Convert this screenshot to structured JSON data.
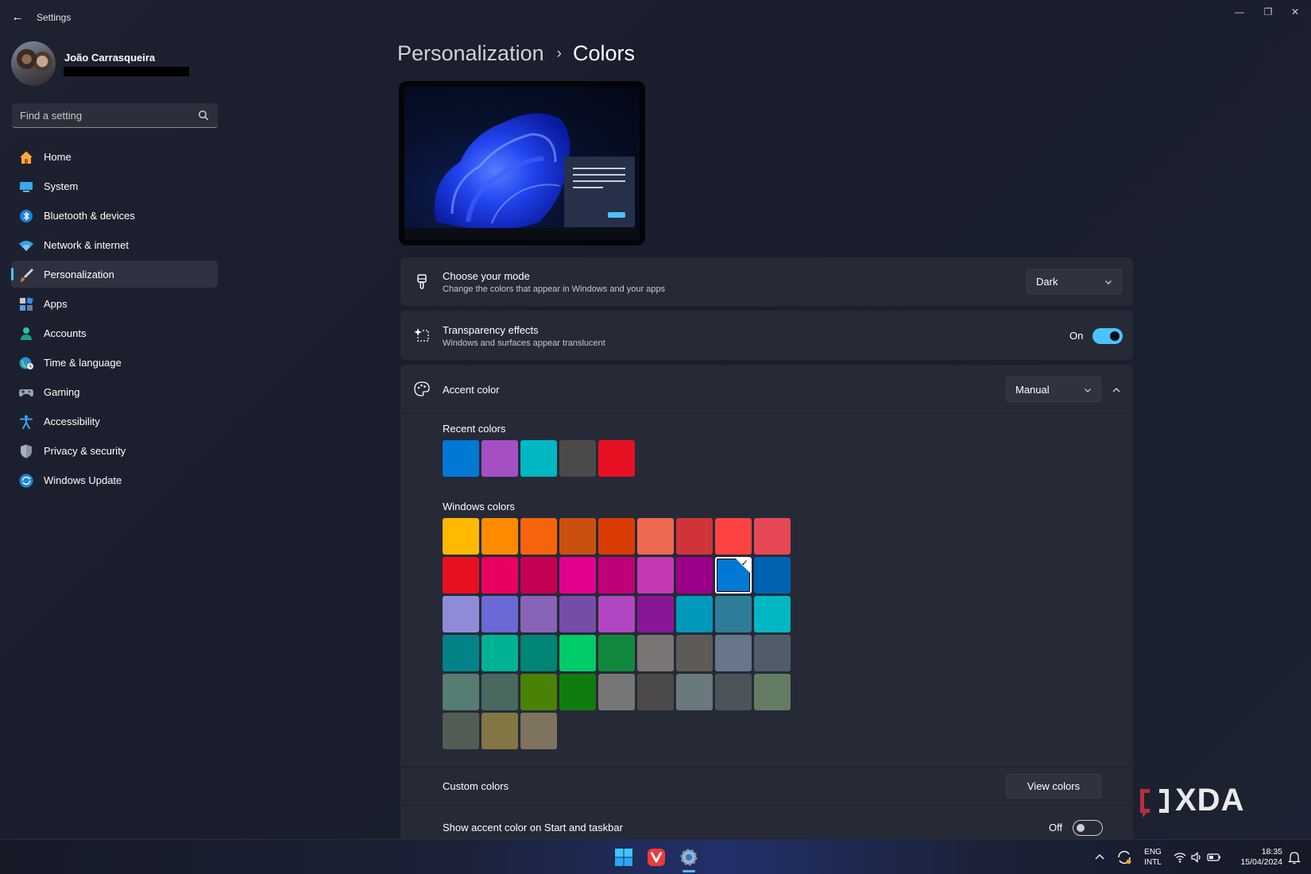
{
  "window": {
    "title": "Settings",
    "minimize": "—",
    "restore": "❐",
    "close": "✕"
  },
  "profile": {
    "name": "João Carrasqueira"
  },
  "search": {
    "placeholder": "Find a setting"
  },
  "sidebar": {
    "items": [
      {
        "label": "Home",
        "icon": "home-icon"
      },
      {
        "label": "System",
        "icon": "monitor-icon"
      },
      {
        "label": "Bluetooth & devices",
        "icon": "bluetooth-icon"
      },
      {
        "label": "Network & internet",
        "icon": "wifi-icon"
      },
      {
        "label": "Personalization",
        "icon": "brush-icon",
        "active": true
      },
      {
        "label": "Apps",
        "icon": "apps-icon"
      },
      {
        "label": "Accounts",
        "icon": "person-icon"
      },
      {
        "label": "Time & language",
        "icon": "globe-clock-icon"
      },
      {
        "label": "Gaming",
        "icon": "gamepad-icon"
      },
      {
        "label": "Accessibility",
        "icon": "accessibility-icon"
      },
      {
        "label": "Privacy & security",
        "icon": "shield-icon"
      },
      {
        "label": "Windows Update",
        "icon": "update-icon"
      }
    ]
  },
  "header": {
    "parent": "Personalization",
    "separator": "›",
    "current": "Colors"
  },
  "mode": {
    "title": "Choose your mode",
    "subtitle": "Change the colors that appear in Windows and your apps",
    "value": "Dark"
  },
  "transparency": {
    "title": "Transparency effects",
    "subtitle": "Windows and surfaces appear translucent",
    "state_label": "On",
    "enabled": true
  },
  "accent": {
    "title": "Accent color",
    "value": "Manual",
    "recent_label": "Recent colors",
    "recent_colors": [
      "#0078d4",
      "#a64fc3",
      "#00b7c3",
      "#4c4a48",
      "#e81123"
    ],
    "windows_label": "Windows colors",
    "windows_colors": [
      "#ffb900",
      "#ff8c00",
      "#f7630c",
      "#ca5010",
      "#da3b01",
      "#ef6950",
      "#d13438",
      "#ff4343",
      "#e74856",
      "#e81123",
      "#ea005e",
      "#c30052",
      "#e3008c",
      "#bf0077",
      "#c239b3",
      "#9a0089",
      "#0078d4",
      "#0063b1",
      "#8e8cd8",
      "#6b69d6",
      "#8764b8",
      "#744da9",
      "#b146c2",
      "#881798",
      "#0099bc",
      "#2d7d9a",
      "#00b7c3",
      "#038387",
      "#00b294",
      "#018574",
      "#00cc6a",
      "#10893e",
      "#7a7574",
      "#5d5a58",
      "#68768a",
      "#515c6b",
      "#567c73",
      "#486860",
      "#498205",
      "#107c10",
      "#767676",
      "#4c4a48",
      "#69797e",
      "#4a5459",
      "#647c64",
      "#525e54",
      "#847545",
      "#7e735f"
    ],
    "selected_color": "#0078d4",
    "check_glyph": "✓",
    "custom_label": "Custom colors",
    "view_colors_label": "View colors",
    "show_on_start_label": "Show accent color on Start and taskbar",
    "show_on_start_state": "Off",
    "show_on_start_enabled": false
  },
  "watermark": {
    "text": "XDA"
  },
  "taskbar": {
    "icons": [
      "windows-start-icon",
      "vivaldi-browser-icon",
      "settings-app-icon"
    ],
    "tray": {
      "lang_top": "ENG",
      "lang_bottom": "INTL",
      "time": "18:35",
      "date": "15/04/2024"
    }
  },
  "colors": {
    "accent": "#4cc2ff",
    "card": "#262a37"
  }
}
